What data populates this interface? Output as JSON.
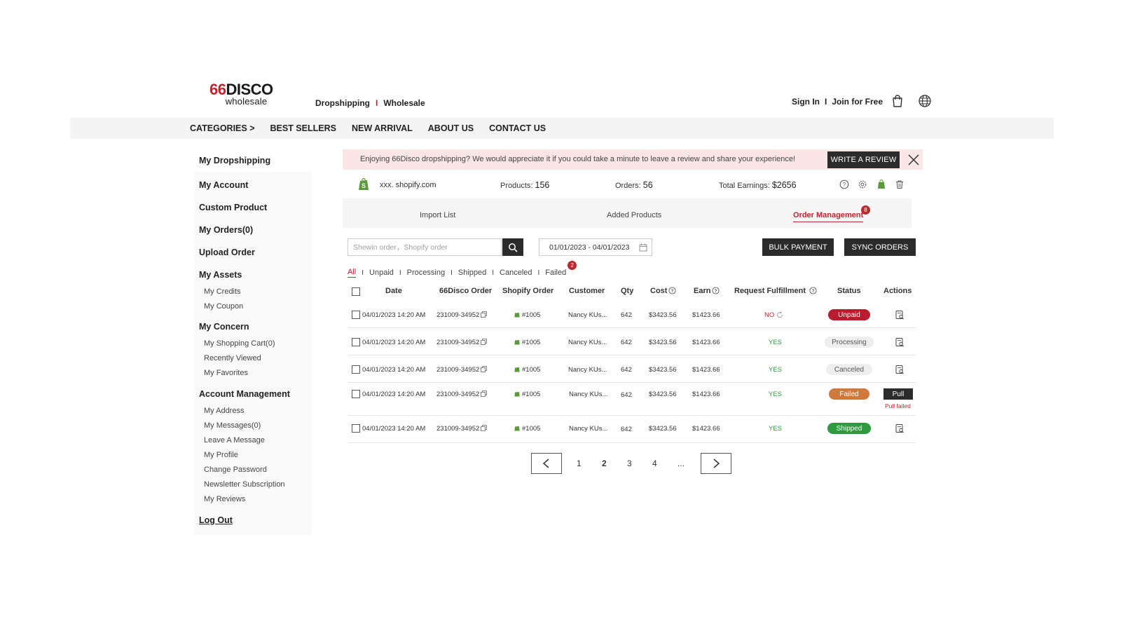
{
  "brand": {
    "logo_num": "66",
    "logo_word": "DISCO",
    "logo_sub": "wholesale"
  },
  "header": {
    "modes": [
      "Dropshipping",
      "Wholesale"
    ],
    "mode_separator": "I",
    "sign_in": "Sign In",
    "auth_separator": "I",
    "join": "Join for Free",
    "icons": {
      "bag": "shopping-bag-icon",
      "globe": "globe-icon"
    }
  },
  "nav": [
    "CATEGORIES >",
    "BEST SELLERS",
    "NEW ARRIVAL",
    "ABOUT US",
    "CONTACT US"
  ],
  "sidebar": {
    "title": "My Dropshipping",
    "my_account": "My Account",
    "custom_product": "Custom Product",
    "my_orders": "My Orders(0)",
    "upload_order": "Upload Order",
    "my_assets": {
      "label": "My Assets",
      "items": [
        "My Credits",
        "My Coupon"
      ]
    },
    "my_concern": {
      "label": "My Concern",
      "items": [
        "My Shopping Cart(0)",
        "Recently Viewed",
        "My Favorites"
      ]
    },
    "account_management": {
      "label": "Account Management",
      "items": [
        "My Address",
        "My Messages(0)",
        "Leave A Message",
        "My Profile",
        "Change Password",
        "Newsletter Subscription",
        "My Reviews"
      ]
    },
    "log_out": "Log Out"
  },
  "banner": {
    "text": "Enjoying 66Disco dropshipping? We would appreciate it if you could take a minute to leave a review and share your experience!",
    "button": "WRITE A REVIEW"
  },
  "store": {
    "name": "xxx. shopify.com",
    "products_label": "Products:",
    "products_value": "156",
    "orders_label": "Orders:",
    "orders_value": "56",
    "earnings_label": "Total Earnings:",
    "earnings_value": "$2656",
    "icons": [
      "help-icon",
      "settings-icon",
      "shopify-icon",
      "trash-icon"
    ]
  },
  "tabs": {
    "items": [
      "Import List",
      "Added Products",
      "Order Management"
    ],
    "active": "Order Management",
    "badge": "8"
  },
  "filters": {
    "search_placeholder": "Shewin order，Shopify order",
    "date_range": "01/01/2023 - 04/01/2023",
    "bulk_payment": "BULK PAYMENT",
    "sync_orders": "SYNC ORDERS",
    "status_tabs": [
      "All",
      "Unpaid",
      "Processing",
      "Shipped",
      "Canceled",
      "Failed"
    ],
    "status_separator": "I",
    "active_status": "All",
    "failed_badge": "2"
  },
  "table": {
    "columns": [
      "Date",
      "66Disco Order",
      "Shopify  Order",
      "Customer",
      "Qty",
      "Cost",
      "Earn",
      "Request Fulfillment",
      "Status",
      "Actions"
    ],
    "rows": [
      {
        "date": "04/01/2023 14:20 AM",
        "disco_order": "231009-34952",
        "shopify_order": "#1005",
        "customer": "Nancy KUs...",
        "qty": "642",
        "cost": "$3423.56",
        "earn": "$1423.66",
        "fulfillment": "NO",
        "status": "Unpaid",
        "status_color": "#b81c2d"
      },
      {
        "date": "04/01/2023 14:20 AM",
        "disco_order": "231009-34952",
        "shopify_order": "#1005",
        "customer": "Nancy KUs...",
        "qty": "642",
        "cost": "$3423.56",
        "earn": "$1423.66",
        "fulfillment": "YES",
        "status": "Processing",
        "status_color": "#eeeeee"
      },
      {
        "date": "04/01/2023 14:20 AM",
        "disco_order": "231009-34952",
        "shopify_order": "#1005",
        "customer": "Nancy KUs...",
        "qty": "642",
        "cost": "$3423.56",
        "earn": "$1423.66",
        "fulfillment": "YES",
        "status": "Canceled",
        "status_color": "#eeeeee"
      },
      {
        "date": "04/01/2023 14:20 AM",
        "disco_order": "231009-34952",
        "shopify_order": "#1005",
        "customer": "Nancy KUs...",
        "qty": "642",
        "cost": "$3423.56",
        "earn": "$1423.66",
        "fulfillment": "YES",
        "status": "Failed",
        "status_color": "#cf7a3c",
        "action_button": "Pull",
        "action_note": "Pull failed"
      },
      {
        "date": "04/01/2023 14:20 AM",
        "disco_order": "231009-34952",
        "shopify_order": "#1005",
        "customer": "Nancy KUs...",
        "qty": "642",
        "cost": "$3423.56",
        "earn": "$1423.66",
        "fulfillment": "YES",
        "status": "Shipped",
        "status_color": "#2d9a3f"
      }
    ]
  },
  "pagination": {
    "pages": [
      "1",
      "2",
      "3",
      "4",
      "..."
    ],
    "current": "2"
  },
  "colors": {
    "accent": "#c0262d",
    "dark": "#2b2b2b",
    "success": "#2d9a3f",
    "banner_bg": "#fbe6e7"
  }
}
